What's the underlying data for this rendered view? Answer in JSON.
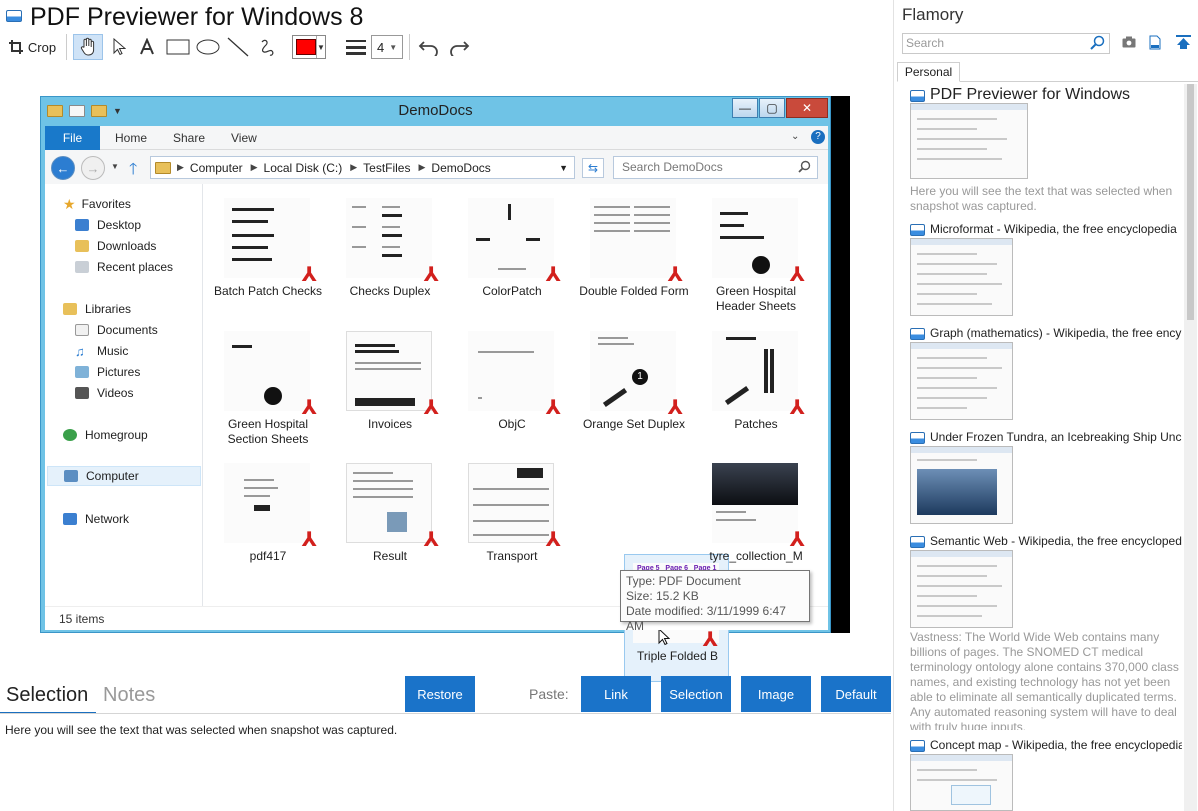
{
  "app": {
    "title": "PDF Previewer for Windows 8"
  },
  "toolbar": {
    "crop_label": "Crop",
    "line_width_value": "4",
    "stroke_color": "#ff0000"
  },
  "screenshot": {
    "window_title": "DemoDocs",
    "ribbon_tabs": [
      "File",
      "Home",
      "Share",
      "View"
    ],
    "breadcrumb": [
      "Computer",
      "Local Disk (C:)",
      "TestFiles",
      "DemoDocs"
    ],
    "search_placeholder": "Search DemoDocs",
    "nav": {
      "favorites": "Favorites",
      "desktop": "Desktop",
      "downloads": "Downloads",
      "recent": "Recent places",
      "libraries": "Libraries",
      "documents": "Documents",
      "music": "Music",
      "pictures": "Pictures",
      "videos": "Videos",
      "homegroup": "Homegroup",
      "computer": "Computer",
      "network": "Network"
    },
    "files": [
      {
        "name": "Batch Patch Checks"
      },
      {
        "name": "Checks Duplex"
      },
      {
        "name": "ColorPatch"
      },
      {
        "name": "Double Folded Form"
      },
      {
        "name": "Green Hospital Header Sheets"
      },
      {
        "name": "Green Hospital Section Sheets"
      },
      {
        "name": "Invoices"
      },
      {
        "name": "ObjC"
      },
      {
        "name": "Orange Set Duplex"
      },
      {
        "name": "Patches"
      },
      {
        "name": "pdf417"
      },
      {
        "name": "Result"
      },
      {
        "name": "Transport"
      },
      {
        "name": "Triple Folded B"
      },
      {
        "name": "tyre_collection_M"
      }
    ],
    "status": "15 items",
    "tooltip": {
      "type": "Type: PDF Document",
      "size": "Size: 15.2 KB",
      "modified": "Date modified: 3/11/1999 6:47 AM"
    }
  },
  "bottom": {
    "tabs": {
      "selection": "Selection",
      "notes": "Notes"
    },
    "restore": "Restore",
    "paste_label": "Paste:",
    "paste_buttons": {
      "link": "Link",
      "selection": "Selection",
      "image": "Image",
      "default": "Default"
    },
    "selection_text": "Here you will see the text that was selected when snapshot was captured."
  },
  "right_panel": {
    "title": "Flamory",
    "search_placeholder": "Search",
    "tab": "Personal",
    "snapshots": [
      {
        "title": "PDF Previewer for Windows",
        "note": "Here you will see the text that was selected when snapshot was captured."
      },
      {
        "title": "Microformat - Wikipedia, the free encyclopedia"
      },
      {
        "title": "Graph (mathematics) - Wikipedia, the free ency"
      },
      {
        "title": "Under Frozen Tundra, an Icebreaking Ship Unco"
      },
      {
        "title": "Semantic Web - Wikipedia, the free encycloped",
        "note": "Vastness: The World Wide Web contains many billions of pages. The SNOMED CT medical terminology ontology alone contains 370,000 class names, and existing technology has not yet been able to eliminate all semantically duplicated terms. Any automated reasoning system will have to deal with truly huge inputs."
      },
      {
        "title": "Concept map - Wikipedia, the free encyclopedia"
      }
    ]
  },
  "colors": {
    "accent": "#1a73c9",
    "explorer_frame": "#6fc3e6",
    "pdf_icon": "#d2201d"
  }
}
